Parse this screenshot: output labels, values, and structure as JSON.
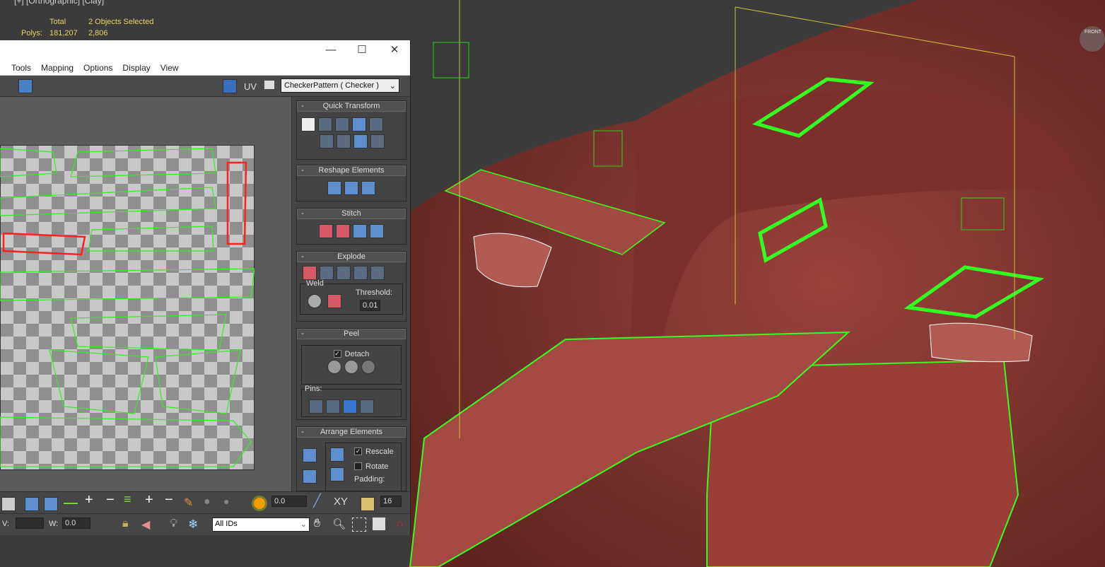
{
  "viewport": {
    "label": "[+] [Orthographic] [Clay]",
    "stats": {
      "total_label": "Total",
      "selected_label": "2 Objects Selected",
      "polys_label": "Polys:",
      "polys_total": "181,207",
      "polys_selected": "2,806"
    },
    "viewcube_label": "FRONT"
  },
  "uv_editor": {
    "window_controls": {
      "minimize": "—",
      "maximize": "☐",
      "close": "✕"
    },
    "menu": [
      "Tools",
      "Mapping",
      "Options",
      "Display",
      "View"
    ],
    "toolbar": {
      "uv_label": "UV",
      "texture_dropdown": "CheckerPattern  ( Checker )"
    },
    "rollouts": {
      "quick_transform": "Quick Transform",
      "reshape": "Reshape Elements",
      "stitch": "Stitch",
      "explode": "Explode",
      "weld": "Weld",
      "threshold_label": "Threshold:",
      "threshold": "0.01",
      "peel": "Peel",
      "detach_label": "Detach",
      "detach_checked": true,
      "pins_label": "Pins:",
      "arrange": "Arrange Elements",
      "rescale_label": "Rescale",
      "rescale_checked": true,
      "rotate_label": "Rotate",
      "rotate_checked": false,
      "padding_label": "Padding:"
    },
    "bottom1": {
      "soft_value": "0.0",
      "axis_label": "XY",
      "grid_value": "16"
    },
    "bottom2": {
      "v_label": "V:",
      "v_value": "",
      "w_label": "W:",
      "w_value": "0.0",
      "id_dropdown": "All IDs"
    }
  },
  "colors": {
    "selection_green": "#33ff22",
    "car_red": "#8e3a34",
    "selected_uv_red": "#ff2020"
  }
}
